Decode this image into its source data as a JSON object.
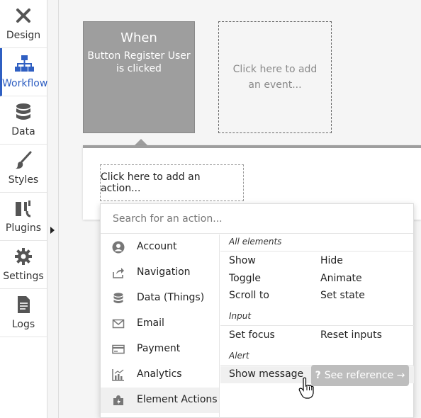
{
  "sidebar": {
    "items": [
      {
        "label": "Design",
        "icon": "design-icon"
      },
      {
        "label": "Workflow",
        "icon": "workflow-icon",
        "active": true
      },
      {
        "label": "Data",
        "icon": "database-icon"
      },
      {
        "label": "Styles",
        "icon": "brush-icon"
      },
      {
        "label": "Plugins",
        "icon": "plug-icon"
      },
      {
        "label": "Settings",
        "icon": "gear-icon"
      },
      {
        "label": "Logs",
        "icon": "document-icon"
      }
    ],
    "active_color": "#2f5fc2"
  },
  "event": {
    "title": "When",
    "description": "Button Register User is clicked",
    "add_event": "Click here to add an event..."
  },
  "action": {
    "add_action": "Click here to add an action..."
  },
  "dropdown": {
    "search_placeholder": "Search for an action...",
    "categories": [
      {
        "label": "Account",
        "icon": "user-icon"
      },
      {
        "label": "Navigation",
        "icon": "share-icon"
      },
      {
        "label": "Data (Things)",
        "icon": "database-icon"
      },
      {
        "label": "Email",
        "icon": "envelope-icon"
      },
      {
        "label": "Payment",
        "icon": "credit-card-icon"
      },
      {
        "label": "Analytics",
        "icon": "chart-icon"
      },
      {
        "label": "Element Actions",
        "icon": "puzzle-icon",
        "active": true
      }
    ],
    "sections": [
      {
        "title": "All elements",
        "actions": [
          "Show",
          "Hide",
          "Toggle",
          "Animate",
          "Scroll to",
          "Set state"
        ]
      },
      {
        "title": "Input",
        "actions": [
          "Set focus",
          "Reset inputs"
        ]
      },
      {
        "title": "Alert",
        "actions": [
          "Show message"
        ]
      }
    ],
    "see_reference": "See reference →",
    "see_reference_q": "?"
  }
}
